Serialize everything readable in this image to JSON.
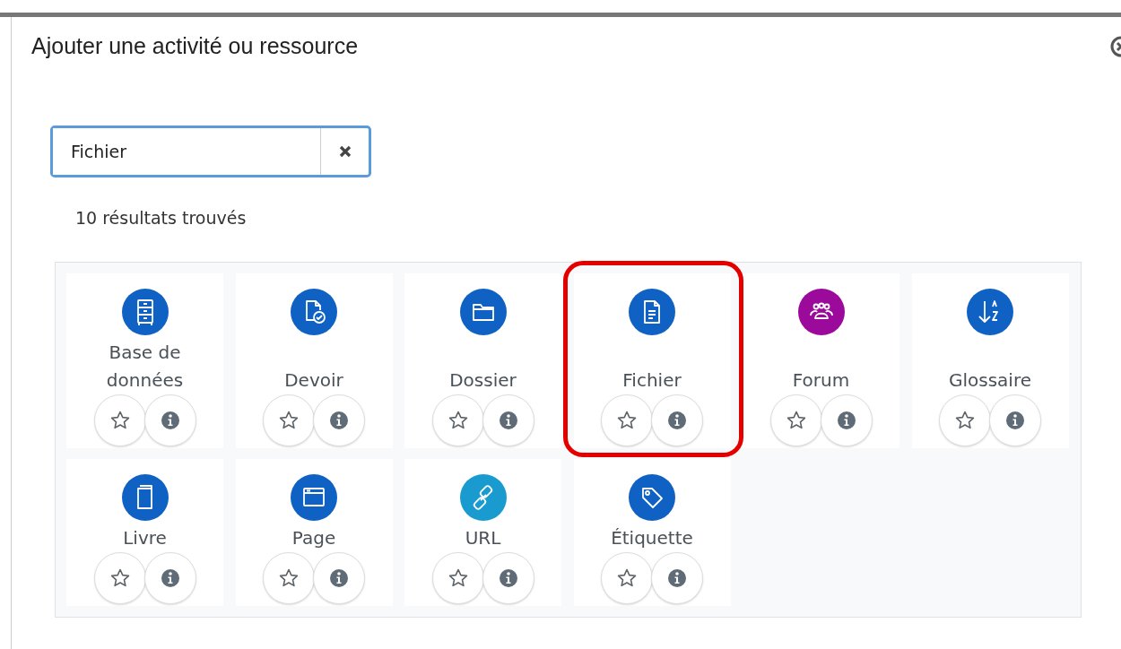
{
  "dialog": {
    "title": "Ajouter une activité ou ressource"
  },
  "search": {
    "value": "Fichier"
  },
  "results_count": "10 résultats trouvés",
  "items": [
    {
      "label": "Base de données",
      "kind": "database",
      "color": "#0f62c4",
      "highlighted": false
    },
    {
      "label": "Devoir",
      "kind": "assignment",
      "color": "#0f62c4",
      "highlighted": false
    },
    {
      "label": "Dossier",
      "kind": "folder",
      "color": "#0f62c4",
      "highlighted": false
    },
    {
      "label": "Fichier",
      "kind": "file",
      "color": "#0f62c4",
      "highlighted": true
    },
    {
      "label": "Forum",
      "kind": "forum",
      "color": "#9b0a9b",
      "highlighted": false
    },
    {
      "label": "Glossaire",
      "kind": "glossary",
      "color": "#0f62c4",
      "highlighted": false
    },
    {
      "label": "Livre",
      "kind": "book",
      "color": "#0f62c4",
      "highlighted": false
    },
    {
      "label": "Page",
      "kind": "page",
      "color": "#0f62c4",
      "highlighted": false
    },
    {
      "label": "URL",
      "kind": "url",
      "color": "#1a9bcf",
      "highlighted": false
    },
    {
      "label": "Étiquette",
      "kind": "label",
      "color": "#0f62c4",
      "highlighted": false
    }
  ]
}
